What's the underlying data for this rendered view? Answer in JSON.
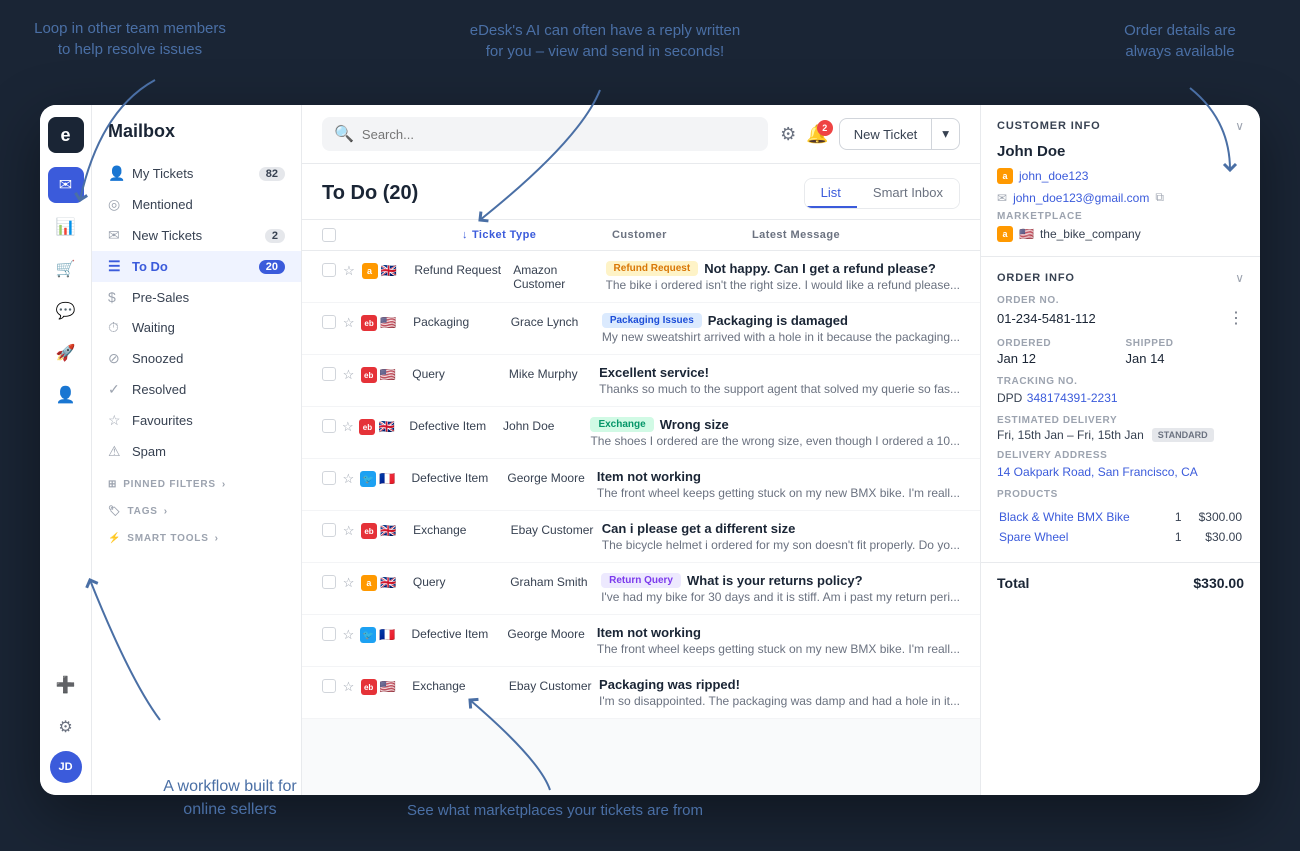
{
  "annotations": {
    "top_left": "Loop in other team members\nto help resolve issues",
    "top_center": "eDesk's AI can often have a reply written\nfor you – view and send in seconds!",
    "top_right": "Order details are\nalways available",
    "bottom_left": "A workflow built for\nonline sellers",
    "bottom_center": "See what marketplaces your tickets are from"
  },
  "header": {
    "title": "Mailbox",
    "search_placeholder": "Search...",
    "new_ticket_label": "New Ticket",
    "notification_count": "2"
  },
  "sidebar": {
    "items": [
      {
        "id": "my-tickets",
        "label": "My Tickets",
        "count": "82",
        "icon": "👤"
      },
      {
        "id": "mentioned",
        "label": "Mentioned",
        "count": "",
        "icon": "◎"
      },
      {
        "id": "new-tickets",
        "label": "New Tickets",
        "count": "2",
        "icon": "✉"
      },
      {
        "id": "to-do",
        "label": "To Do",
        "count": "20",
        "icon": "☰",
        "active": true
      },
      {
        "id": "pre-sales",
        "label": "Pre-Sales",
        "count": "",
        "icon": "$"
      },
      {
        "id": "waiting",
        "label": "Waiting",
        "count": "",
        "icon": "⏱"
      },
      {
        "id": "snoozed",
        "label": "Snoozed",
        "count": "",
        "icon": "⊘"
      },
      {
        "id": "resolved",
        "label": "Resolved",
        "count": "",
        "icon": "✓"
      },
      {
        "id": "favourites",
        "label": "Favourites",
        "count": "",
        "icon": "☆"
      },
      {
        "id": "spam",
        "label": "Spam",
        "count": "",
        "icon": "⚠"
      }
    ],
    "sections": {
      "pinned_filters": "PINNED FILTERS",
      "tags": "TAGS",
      "smart_tools": "SMART TOOLS"
    }
  },
  "ticket_list": {
    "title": "To Do (20)",
    "view_tabs": [
      "List",
      "Smart Inbox"
    ],
    "active_tab": "List",
    "columns": {
      "ticket_type": "Ticket Type",
      "customer": "Customer",
      "latest_message": "Latest Message"
    },
    "tickets": [
      {
        "id": 1,
        "channel": "amazon",
        "flag": "🇬🇧",
        "type": "Refund Request",
        "customer": "Amazon Customer",
        "tag": "Refund Request",
        "tag_class": "tag-refund",
        "subject": "Not happy. Can I get a refund please?",
        "preview": "The bike i ordered isn't the right size. I would like a refund please..."
      },
      {
        "id": 2,
        "channel": "ebay",
        "flag": "🇺🇸",
        "type": "Packaging",
        "customer": "Grace Lynch",
        "tag": "Packaging Issues",
        "tag_class": "tag-packaging",
        "subject": "Packaging is damaged",
        "preview": "My new sweatshirt arrived with a hole in it because the packaging..."
      },
      {
        "id": 3,
        "channel": "ebay",
        "flag": "🇺🇸",
        "type": "Query",
        "customer": "Mike Murphy",
        "tag": "",
        "tag_class": "",
        "subject": "Excellent service!",
        "preview": "Thanks so much to the support agent that solved my querie so fas..."
      },
      {
        "id": 4,
        "channel": "ebay_mobile",
        "flag": "🇬🇧",
        "type": "Defective Item",
        "customer": "John Doe",
        "tag": "Exchange",
        "tag_class": "tag-exchange",
        "subject": "Wrong size",
        "preview": "The shoes I ordered are the wrong size, even though I ordered a 10..."
      },
      {
        "id": 5,
        "channel": "twitter",
        "flag": "🇫🇷",
        "type": "Defective Item",
        "customer": "George Moore",
        "tag": "",
        "tag_class": "",
        "subject": "Item not working",
        "preview": "The front wheel keeps getting stuck on my new BMX bike. I'm reall..."
      },
      {
        "id": 6,
        "channel": "ebay",
        "flag": "🇬🇧",
        "type": "Exchange",
        "customer": "Ebay Customer",
        "tag": "",
        "tag_class": "",
        "subject": "Can i please get a different size",
        "preview": "The bicycle helmet i ordered for my son doesn't fit properly. Do yo..."
      },
      {
        "id": 7,
        "channel": "amazon",
        "flag": "🇬🇧",
        "type": "Query",
        "customer": "Graham Smith",
        "tag": "Return Query",
        "tag_class": "tag-return",
        "subject": "What is your returns policy?",
        "preview": "I've had my bike for 30 days and it is stiff. Am i past my return peri..."
      },
      {
        "id": 8,
        "channel": "twitter",
        "flag": "🇫🇷",
        "type": "Defective Item",
        "customer": "George Moore",
        "tag": "",
        "tag_class": "",
        "subject": "Item not working",
        "preview": "The front wheel keeps getting stuck on my new BMX bike. I'm reall..."
      },
      {
        "id": 9,
        "channel": "ebay",
        "flag": "🇺🇸",
        "type": "Exchange",
        "customer": "Ebay Customer",
        "tag": "",
        "tag_class": "",
        "subject": "Packaging was ripped!",
        "preview": "I'm so disappointed. The packaging was damp and had a hole in it..."
      }
    ]
  },
  "right_panel": {
    "customer_info": {
      "title": "CUSTOMER INFO",
      "name": "John Doe",
      "username": "john_doe123",
      "email": "john_doe123@gmail.com",
      "marketplace_label": "MARKETPLACE",
      "marketplace": "the_bike_company"
    },
    "order_info": {
      "title": "ORDER INFO",
      "order_no_label": "ORDER NO.",
      "order_no": "01-234-5481-112",
      "ordered_label": "ORDERED",
      "ordered": "Jan 12",
      "shipped_label": "SHIPPED",
      "shipped": "Jan 14",
      "tracking_label": "TRACKING NO.",
      "tracking_carrier": "DPD",
      "tracking_no": "348174391-2231",
      "delivery_label": "ESTIMATED DELIVERY",
      "delivery": "Fri, 15th Jan – Fri, 15th Jan",
      "delivery_type": "STANDARD",
      "address_label": "DELIVERY ADDRESS",
      "address": "14 Oakpark Road, San Francisco, CA",
      "products_label": "PRODUCTS",
      "products": [
        {
          "name": "Black & White BMX Bike",
          "qty": "1",
          "price": "$300.00"
        },
        {
          "name": "Spare Wheel",
          "qty": "1",
          "price": "$30.00"
        }
      ],
      "total_label": "Total",
      "total": "$330.00"
    }
  }
}
